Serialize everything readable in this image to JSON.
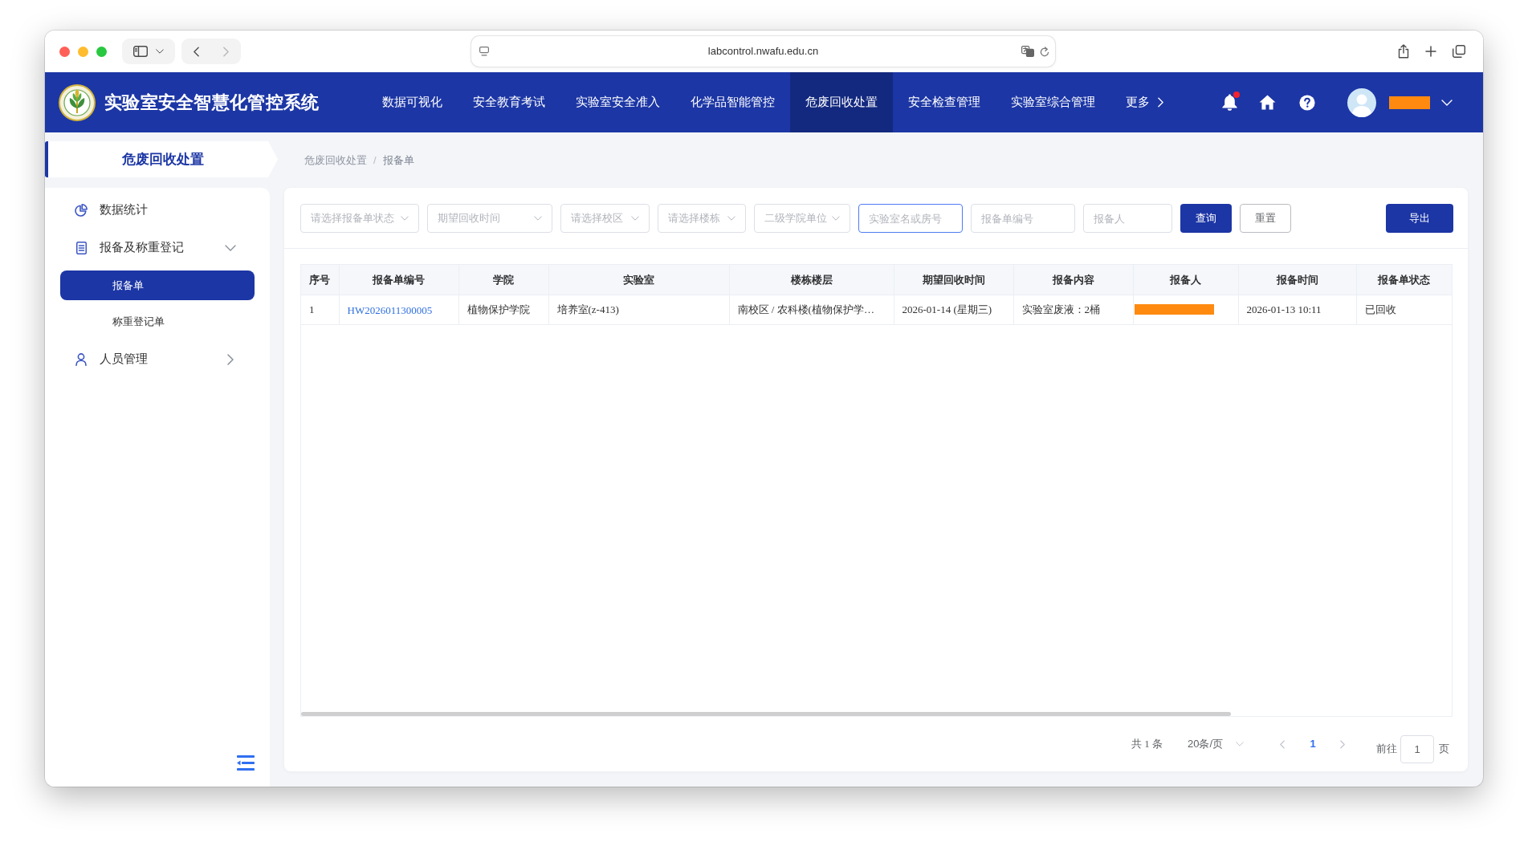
{
  "browser": {
    "url": "labcontrol.nwafu.edu.cn"
  },
  "header": {
    "title": "实验室安全智慧化管控系统",
    "nav": [
      {
        "label": "数据可视化",
        "selected": false,
        "kind": "link"
      },
      {
        "label": "安全教育考试",
        "selected": false,
        "kind": "link"
      },
      {
        "label": "实验室安全准入",
        "selected": false,
        "kind": "link"
      },
      {
        "label": "化学品智能管控",
        "selected": false,
        "kind": "link"
      },
      {
        "label": "危废回收处置",
        "selected": true,
        "kind": "link"
      },
      {
        "label": "安全检查管理",
        "selected": false,
        "kind": "link"
      },
      {
        "label": "实验室综合管理",
        "selected": false,
        "kind": "link"
      },
      {
        "label": "更多",
        "selected": false,
        "kind": "more"
      }
    ],
    "unread_notifications": true
  },
  "sidebar": {
    "title": "危废回收处置",
    "items": [
      {
        "label": "数据统计",
        "kind": "link"
      },
      {
        "label": "报备及称重登记",
        "kind": "group",
        "expanded": true,
        "children": [
          {
            "label": "报备单",
            "selected": true
          },
          {
            "label": "称重登记单",
            "selected": false
          }
        ]
      },
      {
        "label": "人员管理",
        "kind": "group",
        "expanded": false
      }
    ]
  },
  "breadcrumb": {
    "items": [
      "危废回收处置",
      "报备单"
    ],
    "separator": "/"
  },
  "filters": [
    {
      "kind": "select",
      "placeholder": "请选择报备单状态",
      "focused": false
    },
    {
      "kind": "select",
      "placeholder": "期望回收时间",
      "focused": false
    },
    {
      "kind": "select",
      "placeholder": "请选择校区",
      "focused": false
    },
    {
      "kind": "select",
      "placeholder": "请选择楼栋",
      "focused": false
    },
    {
      "kind": "select",
      "placeholder": "二级学院单位",
      "focused": false
    },
    {
      "kind": "input",
      "placeholder": "实验室名或房号",
      "focused": true
    },
    {
      "kind": "input",
      "placeholder": "报备单编号",
      "focused": false
    },
    {
      "kind": "input",
      "placeholder": "报备人",
      "focused": false
    }
  ],
  "actions": [
    {
      "label": "查询",
      "kind": "primary"
    },
    {
      "label": "重置",
      "kind": "default"
    },
    {
      "label": "导出",
      "kind": "export"
    }
  ],
  "table": {
    "columns": [
      "序号",
      "报备单编号",
      "学院",
      "实验室",
      "楼栋楼层",
      "期望回收时间",
      "报备内容",
      "报备人",
      "报备时间",
      "报备单状态"
    ],
    "rows": [
      {
        "cells": [
          {
            "kind": "text",
            "text": "1"
          },
          {
            "kind": "link",
            "text": "HW2026011300005"
          },
          {
            "kind": "text",
            "text": "植物保护学院"
          },
          {
            "kind": "text",
            "text": "培养室(z-413)"
          },
          {
            "kind": "text",
            "text": "南校区 / 农科楼(植物保护学…"
          },
          {
            "kind": "text",
            "text": "2026-01-14 (星期三)"
          },
          {
            "kind": "text",
            "text": "实验室废液：2桶"
          },
          {
            "kind": "redacted"
          },
          {
            "kind": "text",
            "text": "2026-01-13 10:11"
          },
          {
            "kind": "text",
            "text": "已回收"
          }
        ]
      }
    ]
  },
  "pagination": {
    "total": "共 1 条",
    "page_size": "20条/页",
    "prev_disabled": true,
    "pages": [
      {
        "label": "1",
        "selected": true
      }
    ],
    "next_disabled": true,
    "goto_label": "前往",
    "goto_value": "1",
    "goto_suffix": "页"
  }
}
